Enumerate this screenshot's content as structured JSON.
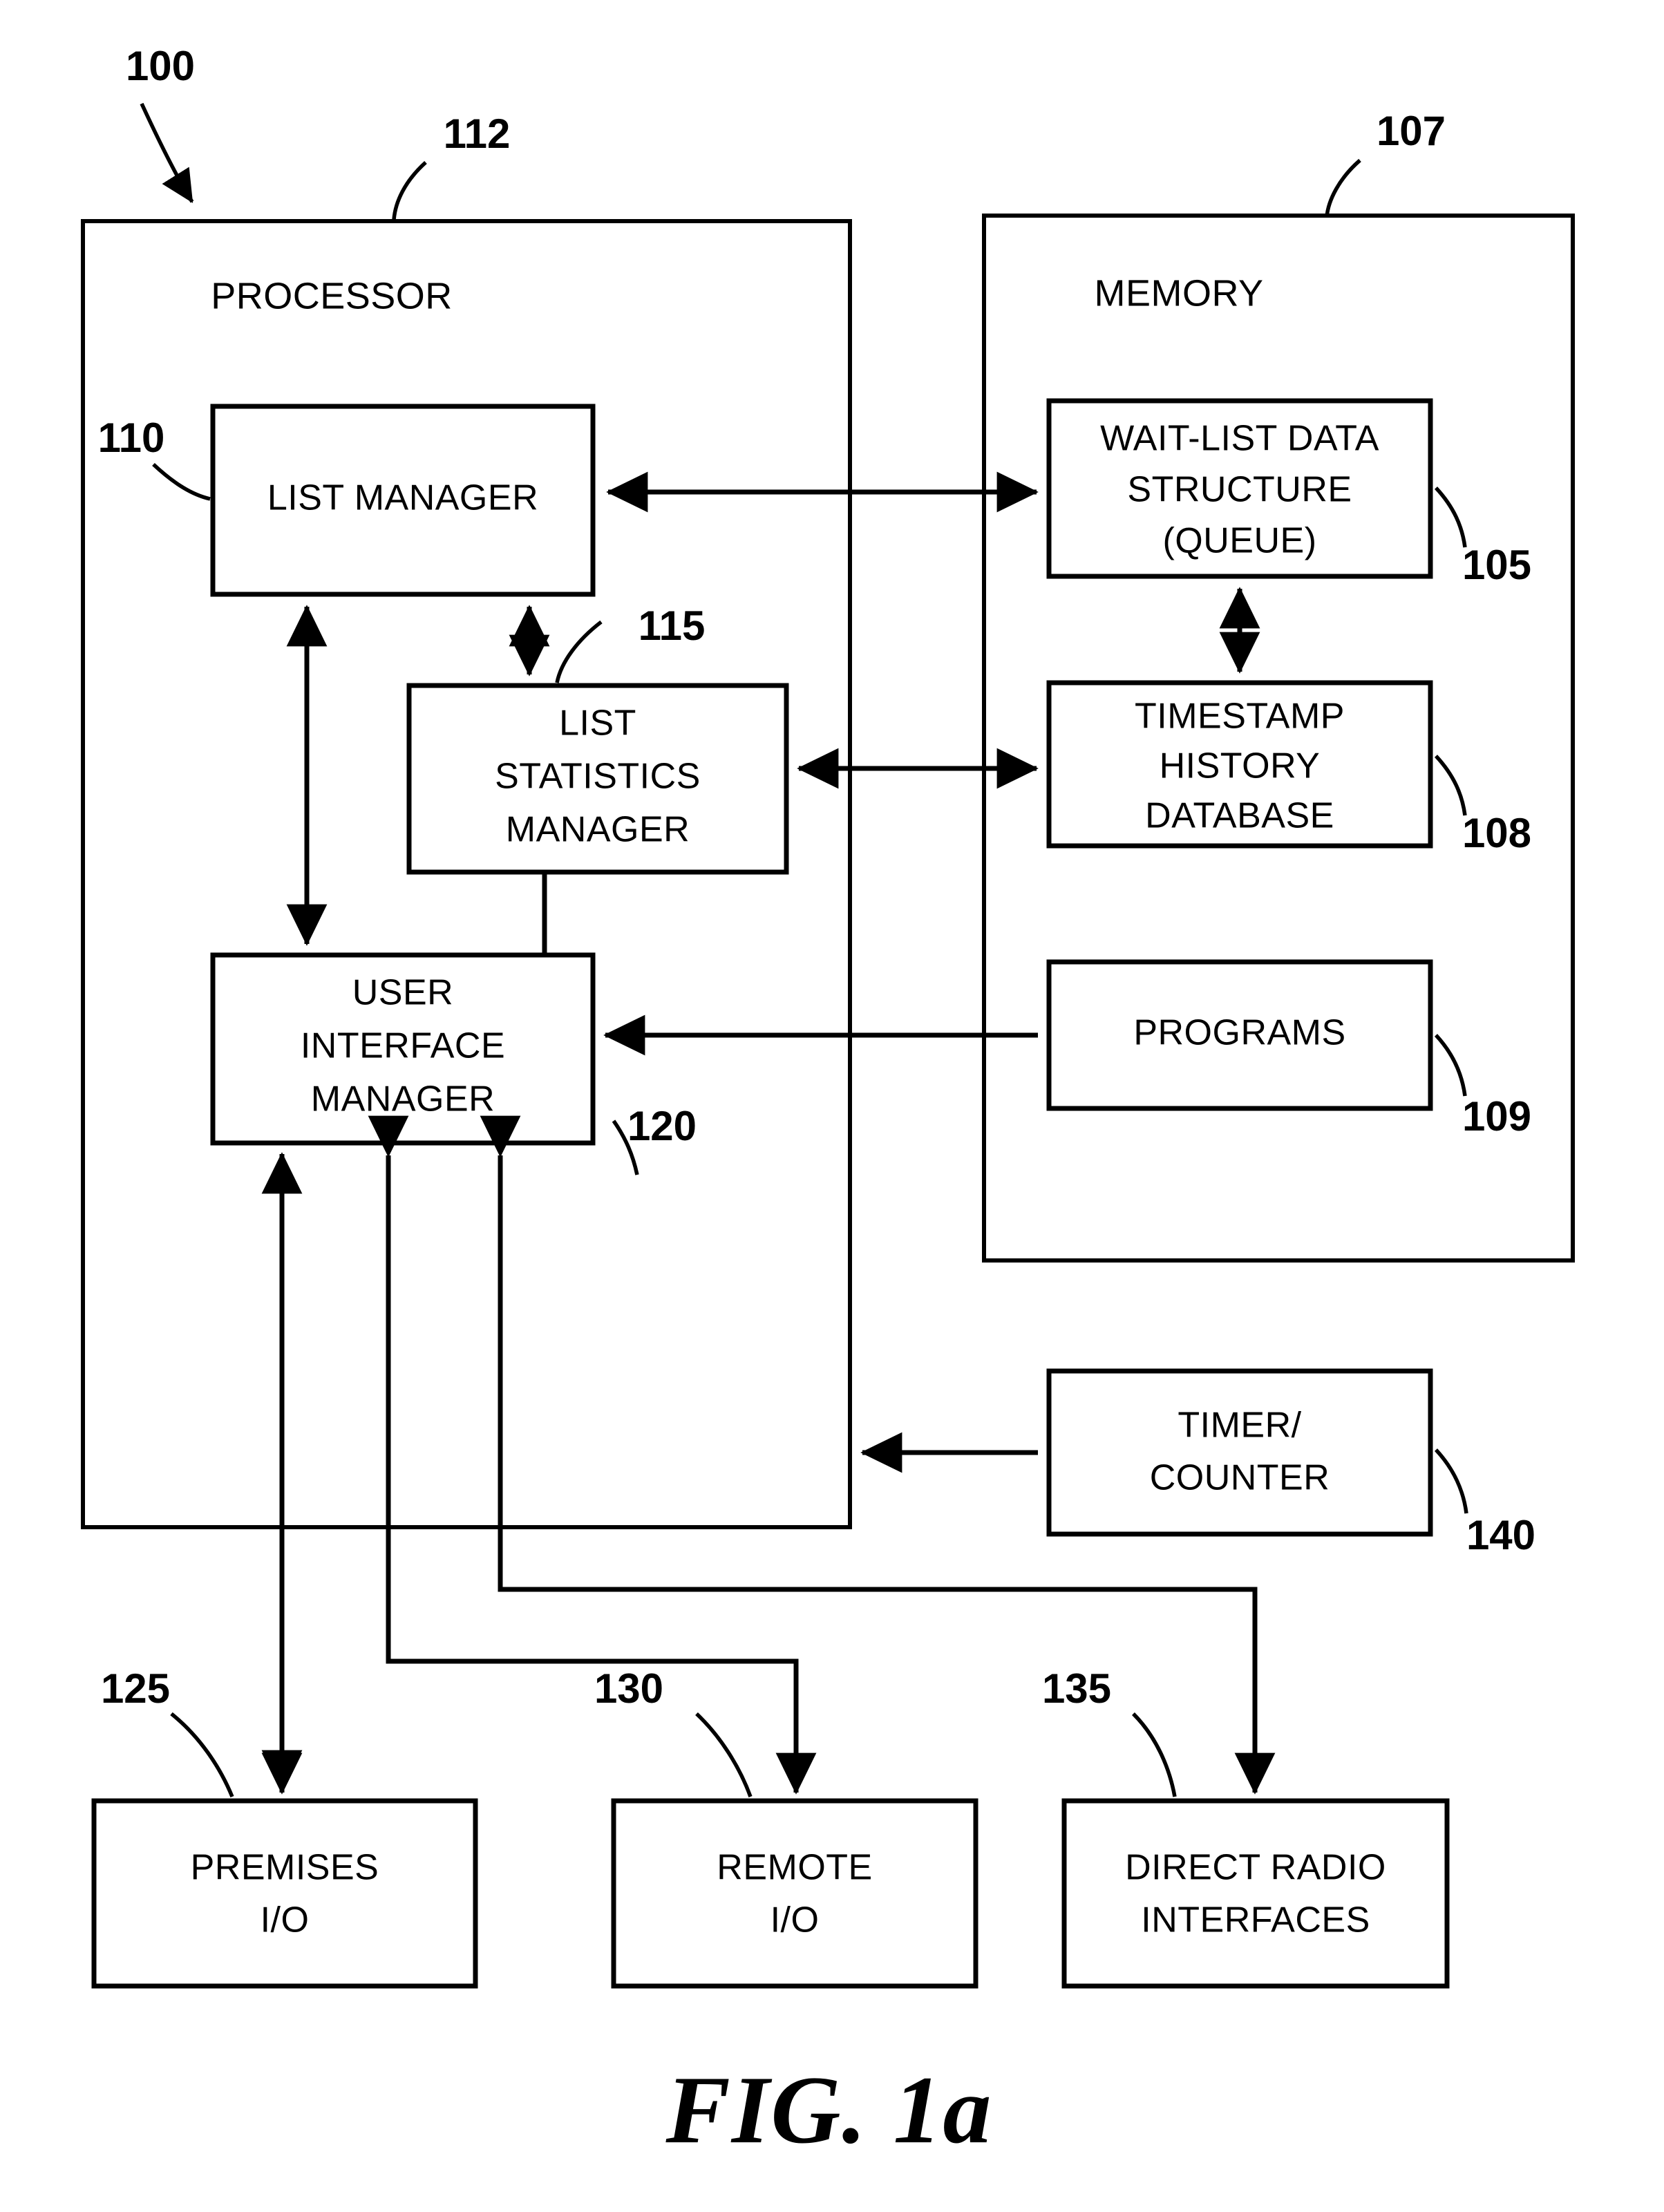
{
  "figure": {
    "caption": "FIG. 1a",
    "system_ref": "100"
  },
  "containers": [
    {
      "id": "processor",
      "label": "PROCESSOR",
      "ref": "112"
    },
    {
      "id": "memory",
      "label": "MEMORY",
      "ref": "107"
    }
  ],
  "blocks": [
    {
      "id": "list-manager",
      "label_lines": [
        "LIST MANAGER"
      ],
      "ref": "110"
    },
    {
      "id": "list-statistics",
      "label_lines": [
        "LIST",
        "STATISTICS",
        "MANAGER"
      ],
      "ref": "115"
    },
    {
      "id": "user-interface",
      "label_lines": [
        "USER",
        "INTERFACE",
        "MANAGER"
      ],
      "ref": "120"
    },
    {
      "id": "wait-list",
      "label_lines": [
        "WAIT-LIST DATA",
        "STRUCTURE",
        "(QUEUE)"
      ],
      "ref": "105"
    },
    {
      "id": "timestamp-history",
      "label_lines": [
        "TIMESTAMP",
        "HISTORY",
        "DATABASE"
      ],
      "ref": "108"
    },
    {
      "id": "programs",
      "label_lines": [
        "PROGRAMS"
      ],
      "ref": "109"
    },
    {
      "id": "timer-counter",
      "label_lines": [
        "TIMER/",
        "COUNTER"
      ],
      "ref": "140"
    },
    {
      "id": "premises-io",
      "label_lines": [
        "PREMISES",
        "I/O"
      ],
      "ref": "125"
    },
    {
      "id": "remote-io",
      "label_lines": [
        "REMOTE",
        "I/O"
      ],
      "ref": "130"
    },
    {
      "id": "direct-radio",
      "label_lines": [
        "DIRECT RADIO",
        "INTERFACES"
      ],
      "ref": "135"
    }
  ],
  "colors": {
    "ink": "#000000",
    "paper": "#ffffff"
  }
}
